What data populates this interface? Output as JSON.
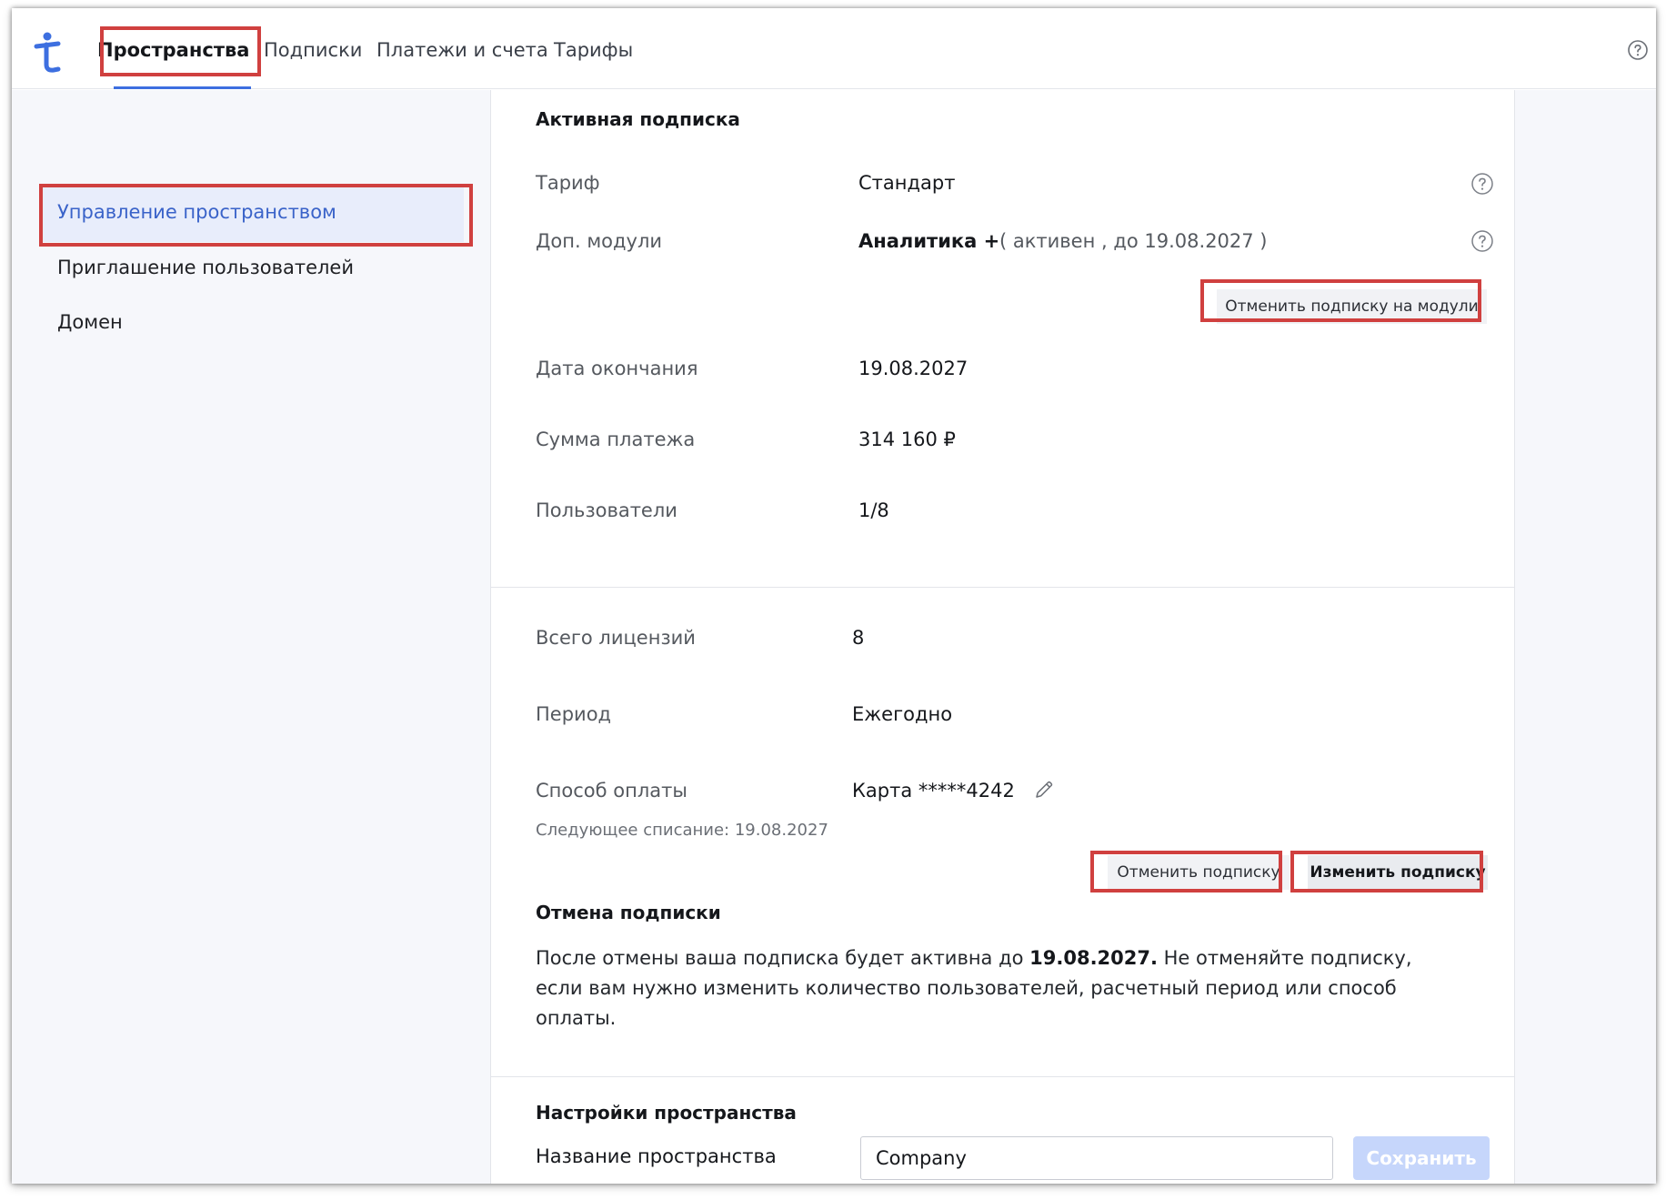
{
  "colors": {
    "accent": "#3d6fe0",
    "annotation": "#d0403f",
    "sidebar_active_bg": "#e8edfb",
    "save_disabled": "#c6d6fb"
  },
  "header": {
    "logo_icon": "t-logo-icon",
    "tabs": [
      {
        "label": "Пространства",
        "active": true
      },
      {
        "label": "Подписки"
      },
      {
        "label": "Платежи и счета"
      },
      {
        "label": "Тарифы"
      }
    ],
    "help_icon": "help-circle-icon"
  },
  "sidebar": {
    "items": [
      {
        "label": "Управление пространством",
        "active": true
      },
      {
        "label": "Приглашение пользователей"
      },
      {
        "label": "Домен"
      }
    ]
  },
  "subscription": {
    "title": "Активная подписка",
    "plan": {
      "label": "Тариф",
      "value": "Стандарт"
    },
    "modules": {
      "label": "Доп. модули",
      "name": "Аналитика +",
      "status": "( активен , до 19.08.2027 )"
    },
    "cancel_modules_button": "Отменить подписку на модули",
    "end_date": {
      "label": "Дата окончания",
      "value": "19.08.2027"
    },
    "amount": {
      "label": "Сумма платежа",
      "value": "314 160 ₽"
    },
    "users": {
      "label": "Пользователи",
      "value": "1/8"
    }
  },
  "billing": {
    "licenses": {
      "label": "Всего лицензий",
      "value": "8"
    },
    "period": {
      "label": "Период",
      "value": "Ежегодно"
    },
    "payment": {
      "label": "Способ оплаты",
      "value": "Карта *****4242",
      "edit_icon": "pencil-icon"
    },
    "next_charge": "Следующее списание: 19.08.2027",
    "cancel_button": "Отменить подписку",
    "change_button": "Изменить подписку"
  },
  "cancellation": {
    "title": "Отмена подписки",
    "text_before": "После отмены ваша подписка будет активна до ",
    "date": "19.08.2027.",
    "text_after": " Не отменяйте подписку, если вам нужно изменить количество пользователей, расчетный период или способ оплаты."
  },
  "settings": {
    "title": "Настройки пространства",
    "name_label": "Название пространства",
    "name_value": "Company",
    "save_button": "Сохранить"
  }
}
